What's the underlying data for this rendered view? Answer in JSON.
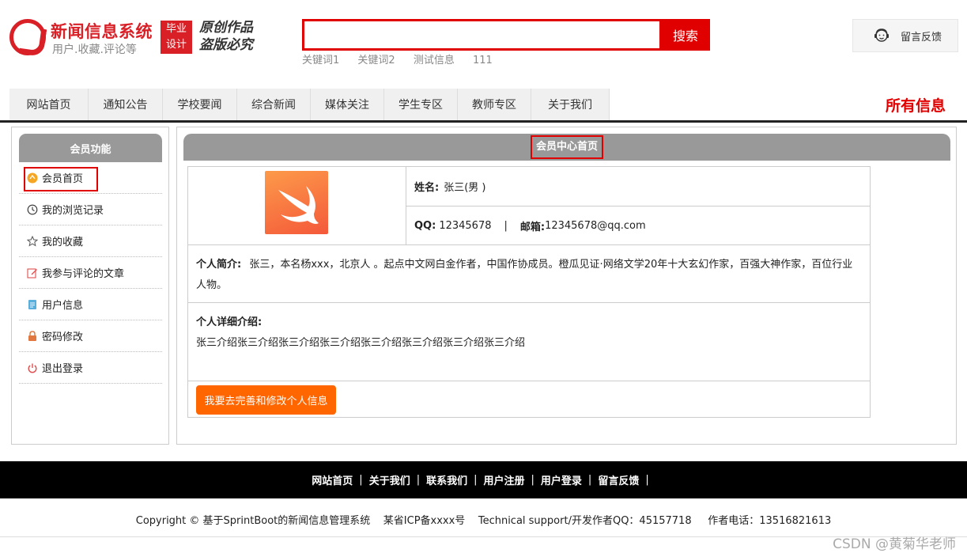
{
  "header": {
    "site_title": "新闻信息系统",
    "site_subtitle": "用户.收藏.评论等",
    "badge_line1": "毕业",
    "badge_line2": "设计",
    "slogan_line1": "原创作品",
    "slogan_line2": "盗版必究",
    "search_value": "",
    "search_button": "搜索",
    "keywords": [
      "关键词1",
      "关键词2",
      "测试信息",
      "111"
    ],
    "feedback_label": "留言反馈"
  },
  "nav": {
    "items": [
      "网站首页",
      "通知公告",
      "学校要闻",
      "综合新闻",
      "媒体关注",
      "学生专区",
      "教师专区",
      "关于我们"
    ],
    "right_title": "所有信息"
  },
  "sidebar": {
    "heading": "会员功能",
    "items": [
      {
        "label": "会员首页",
        "icon": "member-home-icon"
      },
      {
        "label": "我的浏览记录",
        "icon": "history-icon"
      },
      {
        "label": "我的收藏",
        "icon": "star-icon"
      },
      {
        "label": "我参与评论的文章",
        "icon": "edit-icon"
      },
      {
        "label": "用户信息",
        "icon": "document-icon"
      },
      {
        "label": "密码修改",
        "icon": "lock-icon"
      },
      {
        "label": "退出登录",
        "icon": "power-icon"
      }
    ]
  },
  "main": {
    "heading": "会员中心首页",
    "profile": {
      "name_label": "姓名:",
      "name_value": "张三(男 )",
      "qq_label": "QQ:",
      "qq_value": "12345678",
      "separator": "|",
      "email_label": "邮箱:",
      "email_value": "12345678@qq.com",
      "intro_label": "个人简介:",
      "intro_value": "张三，本名杨xxx，北京人 。起点中文网白金作者，中国作协成员。橙瓜见证·网络文学20年十大玄幻作家，百强大神作家，百位行业人物。",
      "detail_label": "个人详细介绍:",
      "detail_value": "张三介绍张三介绍张三介绍张三介绍张三介绍张三介绍张三介绍张三介绍",
      "edit_button": "我要去完善和修改个人信息"
    }
  },
  "footer": {
    "links": [
      "网站首页",
      "关于我们",
      "联系我们",
      "用户注册",
      "用户登录",
      "留言反馈"
    ],
    "copyright": "Copyright © 基于SprintBoot的新闻信息管理系统    某省ICP备xxxx号    Technical support/开发作者QQ：45157718     作者电话：13516821613",
    "watermark": "CSDN @黄菊华老师"
  },
  "colors": {
    "brand_red": "#e10000",
    "logo_red": "#d92027",
    "header_gray": "#999999",
    "button_orange": "#ff6600"
  }
}
